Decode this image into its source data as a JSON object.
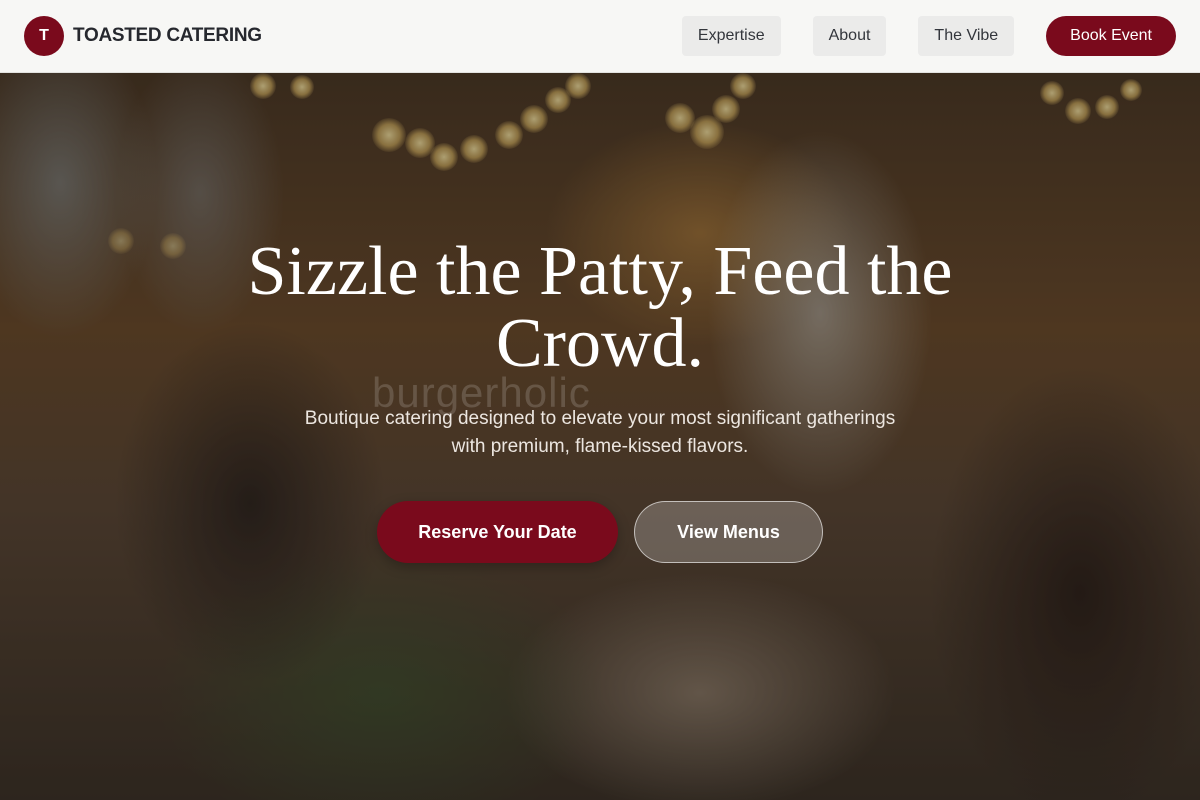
{
  "brand": {
    "logo_letter": "T",
    "name": "TOASTED CATERING"
  },
  "nav": {
    "items": [
      {
        "label": "Expertise"
      },
      {
        "label": "About"
      },
      {
        "label": "The Vibe"
      }
    ],
    "cta_label": "Book Event"
  },
  "hero": {
    "title_line1": "Sizzle the Patty, Feed the",
    "title_line2": "Crowd.",
    "subtitle_line1": "Boutique catering designed to elevate your most significant gatherings",
    "subtitle_line2": "with premium, flame-kissed flavors.",
    "watermark": "burgerholic",
    "primary_cta": "Reserve Your Date",
    "secondary_cta": "View Menus"
  },
  "colors": {
    "accent": "#7a0a1c",
    "header_bg": "#f7f7f5",
    "nav_button_bg": "#ebebea"
  }
}
